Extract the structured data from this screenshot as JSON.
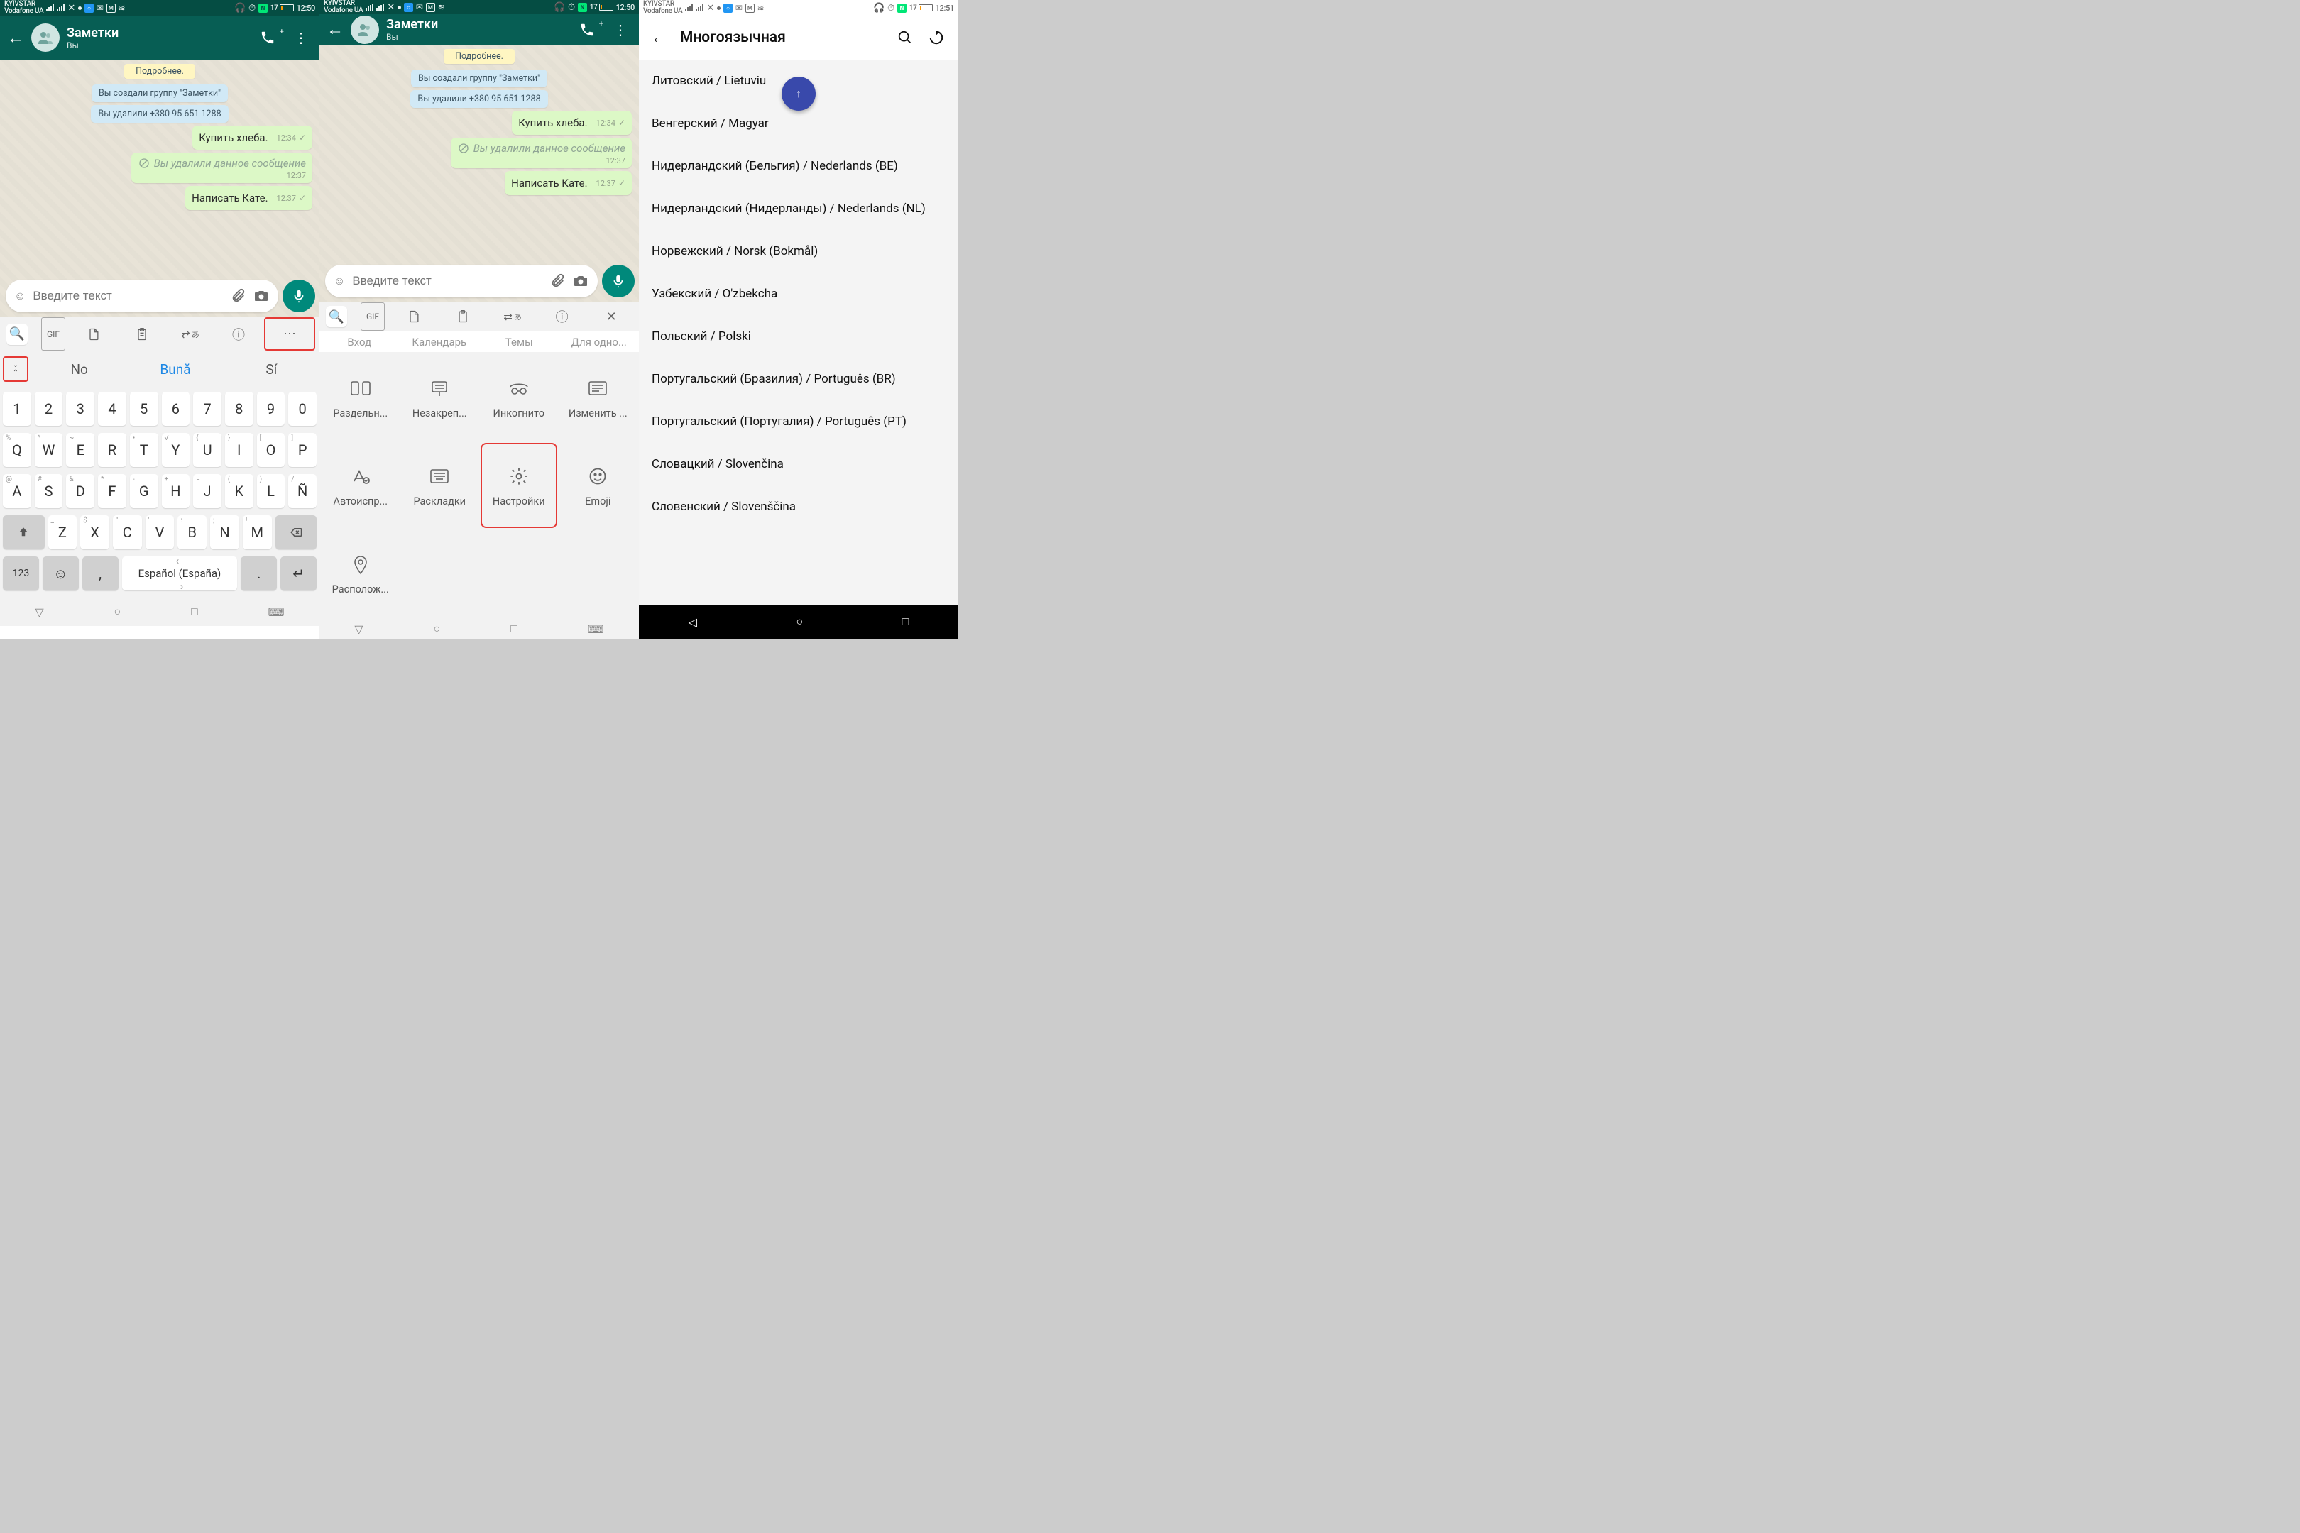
{
  "status": {
    "carrier_top": "KYIVSTAR",
    "carrier_bot": "Vodafone UA",
    "time12": "12:50",
    "time3": "12:51",
    "batt": "17"
  },
  "wa": {
    "title": "Заметки",
    "subtitle": "Вы",
    "more_label": "Подробнее.",
    "sys1": "Вы создали группу \"Заметки\"",
    "sys2": "Вы удалили +380 95 651 1288",
    "m1": "Купить хлеба.",
    "m1_time": "12:34",
    "deleted": "Вы удалили данное сообщение",
    "del_time": "12:37",
    "m2": "Написать Кате.",
    "m2_time": "12:37",
    "placeholder": "Введите текст"
  },
  "sug": {
    "a": "No",
    "b": "Bună",
    "c": "Sí"
  },
  "kb": {
    "row0": [
      "1",
      "2",
      "3",
      "4",
      "5",
      "6",
      "7",
      "8",
      "9",
      "0"
    ],
    "row1": [
      "Q",
      "W",
      "E",
      "R",
      "T",
      "Y",
      "U",
      "I",
      "O",
      "P"
    ],
    "row1sup": [
      "%",
      "^",
      "~",
      "|",
      "•",
      "√",
      "{",
      "}",
      "[",
      "]"
    ],
    "row2": [
      "A",
      "S",
      "D",
      "F",
      "G",
      "H",
      "J",
      "K",
      "L",
      "Ñ"
    ],
    "row2sup": [
      "@",
      "#",
      "&",
      "*",
      "-",
      "+",
      "=",
      "(",
      ")",
      "/"
    ],
    "row3": [
      "Z",
      "X",
      "C",
      "V",
      "B",
      "N",
      "M"
    ],
    "row3sup": [
      "_",
      "$",
      "\"",
      "'",
      ":",
      ";",
      "!"
    ],
    "n123": "123",
    "space": "Español (España)"
  },
  "tabs": [
    "Вход",
    "Календарь",
    "Темы",
    "Для одно..."
  ],
  "opts": [
    {
      "label": "Раздельн...",
      "icon": "split"
    },
    {
      "label": "Незакреп...",
      "icon": "float"
    },
    {
      "label": "Инкогнито",
      "icon": "incog"
    },
    {
      "label": "Изменить ...",
      "icon": "resize"
    },
    {
      "label": "Автоиспр...",
      "icon": "auto"
    },
    {
      "label": "Раскладки",
      "icon": "layout"
    },
    {
      "label": "Настройки",
      "icon": "gear",
      "hl": true
    },
    {
      "label": "Emoji",
      "icon": "emoji"
    },
    {
      "label": "Располож...",
      "icon": "pin"
    }
  ],
  "s3": {
    "title": "Многоязычная",
    "langs": [
      "Литовский / Lietuviu",
      "Венгерский / Magyar",
      "Нидерландский (Бельгия) / Nederlands (BE)",
      "Нидерландский (Нидерланды) / Nederlands (NL)",
      "Норвежский / Norsk (Bokmål)",
      "Узбекский / O'zbekcha",
      "Польский / Polski",
      "Португальский (Бразилия) / Português (BR)",
      "Португальский (Португалия) / Português (PT)",
      "Словацкий / Slovenčina",
      "Словенский / Slovenščina"
    ]
  }
}
